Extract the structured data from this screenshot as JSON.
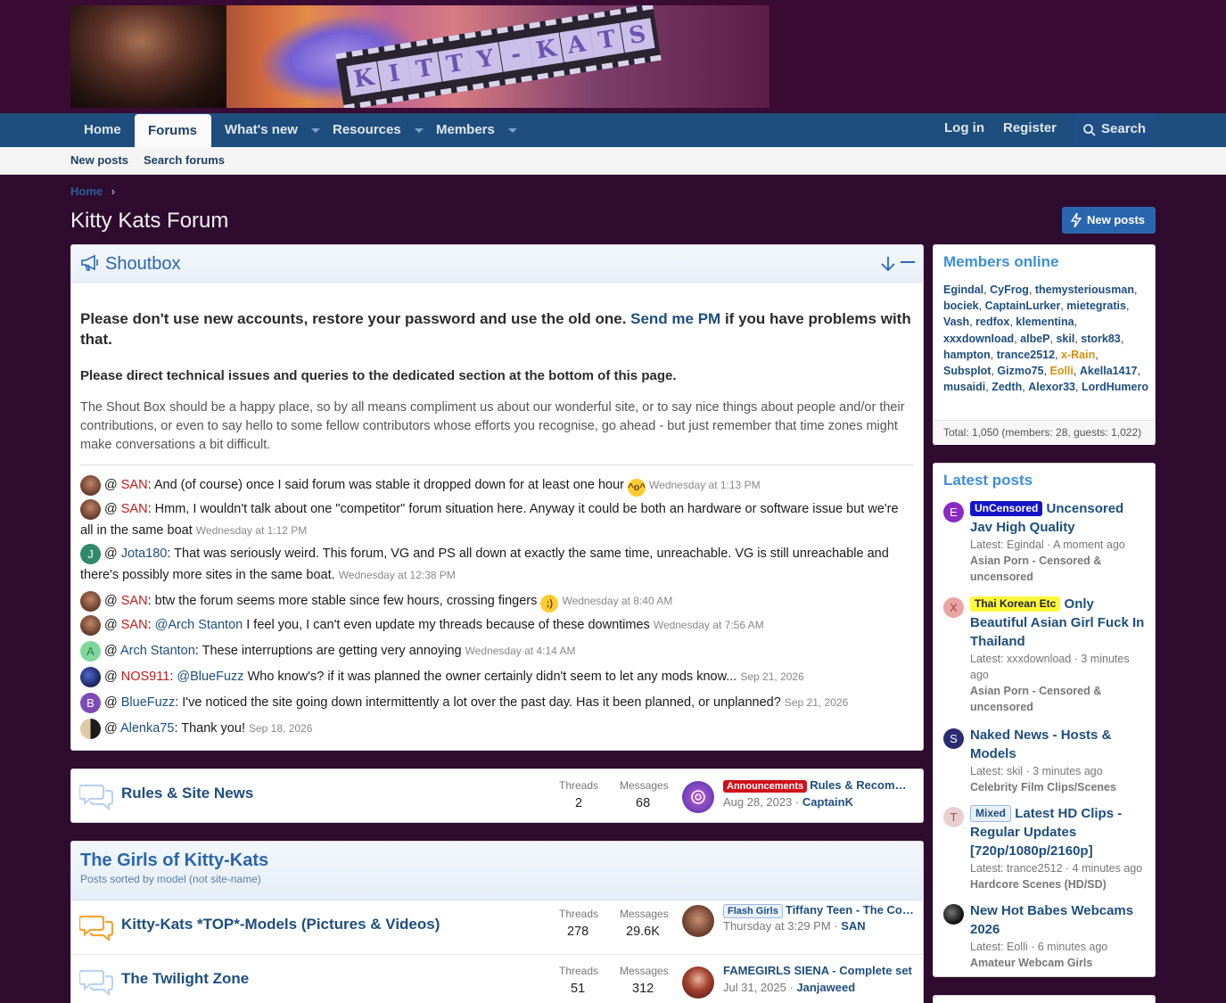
{
  "header": {
    "banner_text": "KITTY-KATS"
  },
  "nav": {
    "home": "Home",
    "forums": "Forums",
    "whats_new": "What's new",
    "resources": "Resources",
    "members": "Members",
    "login": "Log in",
    "register": "Register",
    "search": "Search"
  },
  "subnav": {
    "new_posts": "New posts",
    "search_forums": "Search forums"
  },
  "breadcrumb": {
    "home": "Home"
  },
  "page": {
    "title": "Kitty Kats Forum",
    "new_posts_button": "New posts"
  },
  "shoutbox": {
    "title": "Shoutbox",
    "notice_part1": "Please don't use new accounts, restore your password and use the old one. ",
    "notice_link": "Send me PM",
    "notice_part2": " if you have problems with that.",
    "notice_tech": "Please direct technical issues and queries to the dedicated section at the bottom of this page.",
    "notice_text": "The Shout Box should be a happy place, so by all means compliment us about our wonderful site, or to say nice things about people and/or their contributions, or even to say hello to some fellow contributors whose efforts you recognise, go ahead - but just remember that time zones might make conversations a bit difficult.",
    "at": "@",
    "messages": [
      {
        "user": "SAN",
        "text": ": And (of course) once I said forum was stable it dropped down for at least one hour ",
        "time": "Wednesday at 1:13 PM"
      },
      {
        "user": "SAN",
        "text": ": Hmm, I wouldn't talk about one \"competitor\" forum situation here. Anyway it could be both an hardware or software issue but we're all in the same boat ",
        "time": "Wednesday at 1:12 PM"
      },
      {
        "user": "Jota180",
        "avatar_letter": "J",
        "text": ": That was seriously weird. This forum, VG and PS all down at exactly the same time, unreachable. VG is still unreachable and there's possibly more sites in the same boat. ",
        "time": "Wednesday at 12:38 PM"
      },
      {
        "user": "SAN",
        "text": ": btw the forum seems more stable since few hours, crossing fingers ",
        "time": "Wednesday at 8:40 AM"
      },
      {
        "user": "SAN",
        "mention": "@Arch Stanton",
        "text": " I feel you, I can't even update my threads because of these downtimes ",
        "time": "Wednesday at 7:56 AM"
      },
      {
        "user": "Arch Stanton",
        "avatar_letter": "A",
        "text": ": These interruptions are getting very annoying ",
        "time": "Wednesday at 4:14 AM"
      },
      {
        "user": "NOS911",
        "mention": "@BlueFuzz",
        "text": " Who know's? if it was planned the owner certainly didn't seem to let any mods know... ",
        "time": "Sep 21, 2026"
      },
      {
        "user": "BlueFuzz",
        "avatar_letter": "B",
        "text": ": I've noticed the site going down intermittently a lot over the past day. Has it been planned, or unplanned? ",
        "time": "Sep 21, 2026"
      },
      {
        "user": "Alenka75",
        "text": ": Thank you! ",
        "time": "Sep 18, 2026"
      }
    ]
  },
  "forums": {
    "threads_label": "Threads",
    "messages_label": "Messages",
    "rules": {
      "title": "Rules & Site News",
      "threads": "2",
      "messages": "68",
      "last_prefix": "Announcements",
      "last_title": "Rules & Recommendations",
      "last_date": "Aug 28, 2023",
      "last_user": "CaptainK"
    },
    "category": {
      "title": "The Girls of Kitty-Kats",
      "desc": "Posts sorted by model (not site-name)"
    },
    "top_models": {
      "title": "Kitty-Kats *TOP*-Models (Pictures & Videos)",
      "threads": "278",
      "messages": "29.6K",
      "last_prefix": "Flash Girls",
      "last_title": "Tiffany Teen - The Collection",
      "last_date": "Thursday at 3:29 PM",
      "last_user": "SAN"
    },
    "twilight": {
      "title": "The Twilight Zone",
      "threads": "51",
      "messages": "312",
      "last_title": "FAMEGIRLS SIENA - Complete set",
      "last_date": "Jul 31, 2025",
      "last_user": "Janjaweed"
    }
  },
  "members_online": {
    "title": "Members online",
    "members": [
      "Egindal",
      "CyFrog",
      "themysteriousman",
      "bociek",
      "CaptainLurker",
      "mietegratis",
      "Vash",
      "redfox",
      "klementina",
      "xxxdownload",
      "albeP",
      "skil",
      "stork83",
      "hampton",
      "trance2512",
      "x-Rain",
      "Subsplot",
      "Gizmo75",
      "Eolli",
      "Akella1417",
      "musaidi",
      "Zedth",
      "Alexor33",
      "LordHumero"
    ],
    "total": "Total: 1,050 (members: 28, guests: 1,022)"
  },
  "latest_posts": {
    "title": "Latest posts",
    "items": [
      {
        "avatar_letter": "E",
        "prefix": "UnCensored",
        "title": "Uncensored Jav High Quality",
        "meta": "Latest: Egindal · A moment ago",
        "forum": "Asian Porn - Censored & uncensored"
      },
      {
        "avatar_letter": "X",
        "prefix": "Thai Korean Etc",
        "title": "Only Beautiful Asian Girl Fuck In Thailand",
        "meta": "Latest: xxxdownload · 3 minutes ago",
        "forum": "Asian Porn - Censored & uncensored"
      },
      {
        "avatar_letter": "S",
        "title": "Naked News - Hosts & Models",
        "meta": "Latest: skil · 3 minutes ago",
        "forum": "Celebrity Film Clips/Scenes"
      },
      {
        "avatar_letter": "T",
        "prefix": "Mixed",
        "title": "Latest HD Clips - Regular Updates [720p/1080p/2160p]",
        "meta": "Latest: trance2512 · 4 minutes ago",
        "forum": "Hardcore Scenes (HD/SD)"
      },
      {
        "title": "New Hot Babes Webcams 2026",
        "meta": "Latest: Eolli · 6 minutes ago",
        "forum": "Amateur Webcam Girls"
      }
    ]
  },
  "colors": {
    "page_bg": "#2e0b2f",
    "nav_bg": "#1d4e7d",
    "link": "#1d4e7d",
    "accent": "#2a66ad",
    "staff_red": "#c31a1a",
    "gold": "#d1910f"
  }
}
